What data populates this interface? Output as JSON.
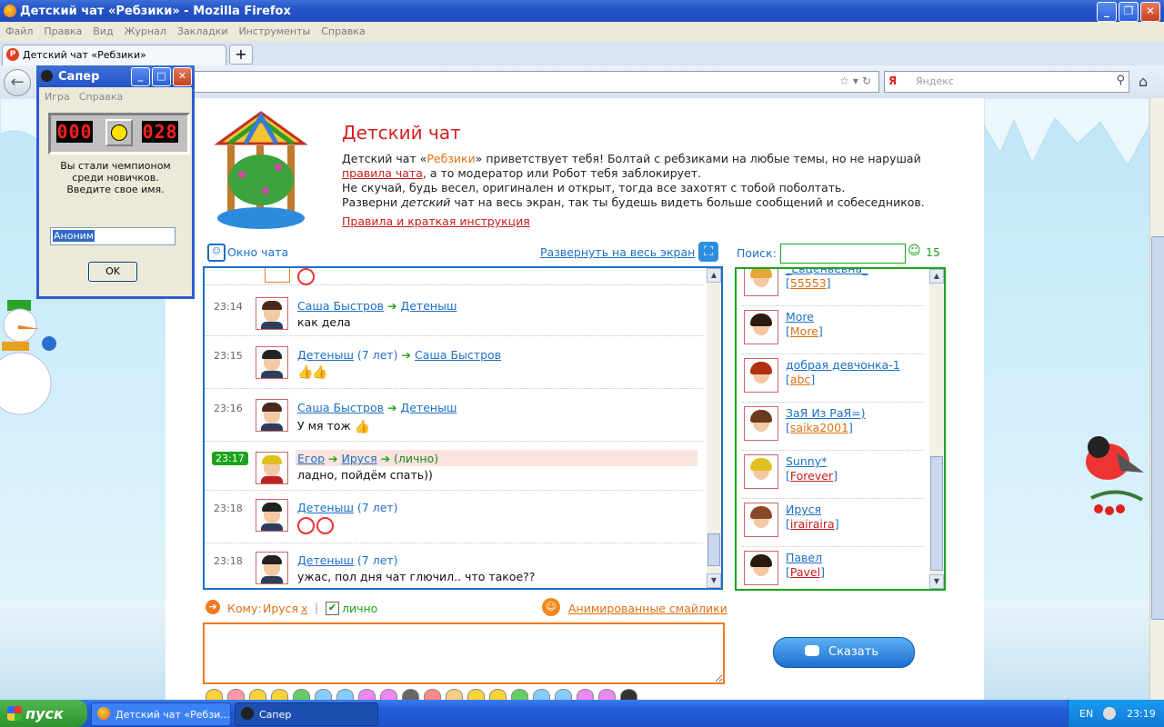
{
  "browser": {
    "window_title": "Детский чат «Ребзики» - Mozilla Firefox",
    "menu": [
      "Файл",
      "Правка",
      "Вид",
      "Журнал",
      "Закладки",
      "Инструменты",
      "Справка"
    ],
    "tab_label": "Детский чат «Ребзики»",
    "tab_icon_letter": "Р",
    "search_placeholder": "Яндекс",
    "search_engine_letter": "Я"
  },
  "header": {
    "title": "Детский чат",
    "line1_a": "Детский чат «",
    "line1_brand": "Ребзики",
    "line1_b": "» приветствует тебя! Болтай с ребзиками на любые темы, но не нарушай",
    "line2_link": "правила чата",
    "line2_rest": ", а то модератор или Робот тебя заблокирует.",
    "line3": "Не скучай, будь весел, оригинален и открыт, тогда все захотят с тобой поболтать.",
    "line4_a": "Разверни ",
    "line4_em": "детский",
    "line4_b": " чат на весь экран, так ты будешь видеть больше сообщений и собеседников.",
    "rules_link": "Правила и краткая инструкция"
  },
  "chat": {
    "window_label": "Окно чата",
    "expand_link": "Развернуть на весь экран",
    "messages": [
      {
        "time": "23:14",
        "from": "Саша Быстров",
        "to": "Детеныш",
        "age": "",
        "private": "",
        "text": "как дела"
      },
      {
        "time": "23:15",
        "from": "Детеныш",
        "age": "(7 лет)",
        "to": "Саша Быстров",
        "private": "",
        "text": ""
      },
      {
        "time": "23:16",
        "from": "Саша Быстров",
        "to": "Детеныш",
        "age": "",
        "private": "",
        "text": "У мя тож"
      },
      {
        "time": "23:17",
        "from": "Егор",
        "to": "Ируся",
        "age": "",
        "private": "(лично)",
        "text": "ладно, пойдём спать))"
      },
      {
        "time": "23:18",
        "from": "Детеныш",
        "age": "(7 лет)",
        "to": "",
        "private": "",
        "text": ""
      },
      {
        "time": "23:18",
        "from": "Детеныш",
        "age": "(7 лет)",
        "to": "",
        "private": "",
        "text": "ужас, пол дня чат глючил.. что такое??"
      }
    ]
  },
  "users": {
    "search_label": "Поиск:",
    "count": "15",
    "list": [
      {
        "nick": "_Евценьевна_",
        "login": "55553",
        "login_color": "org",
        "hair": "#e3a73a"
      },
      {
        "nick": "More",
        "login": "More",
        "login_color": "org",
        "hair": "#2b1a10"
      },
      {
        "nick": "добрая девчонка-1",
        "login": "abc",
        "login_color": "org",
        "hair": "#b03010"
      },
      {
        "nick": "ЗаЯ Из РаЯ=)",
        "login": "saika2001",
        "login_color": "org",
        "hair": "#6a3a1a"
      },
      {
        "nick": "Sunny*",
        "login": "Forever",
        "login_color": "red",
        "hair": "#e0c020"
      },
      {
        "nick": "Ируся",
        "login": "irairaira",
        "login_color": "red",
        "hair": "#8a4a2a"
      },
      {
        "nick": "Павел",
        "login": "Pavel",
        "login_color": "red",
        "hair": "#2a1a10"
      }
    ]
  },
  "compose": {
    "to_label": "Кому:",
    "to_name": "Ируся",
    "to_clear": "х",
    "private_label": "лично",
    "private_checked": true,
    "anim_link": "Анимированные смайлики",
    "say_button": "Сказать"
  },
  "minesweeper": {
    "title": "Сапер",
    "menu": [
      "Игра",
      "Справка"
    ],
    "mines_counter": "000",
    "timer": "028",
    "message_lines": [
      "Вы стали чемпионом",
      "среди новичков.",
      "Введите свое имя."
    ],
    "name_value": "Аноним",
    "ok_button": "OK"
  },
  "taskbar": {
    "start": "пуск",
    "tasks": [
      "Детский чат «Ребзи...",
      "Сапер"
    ],
    "language": "EN",
    "clock": "23:19"
  }
}
